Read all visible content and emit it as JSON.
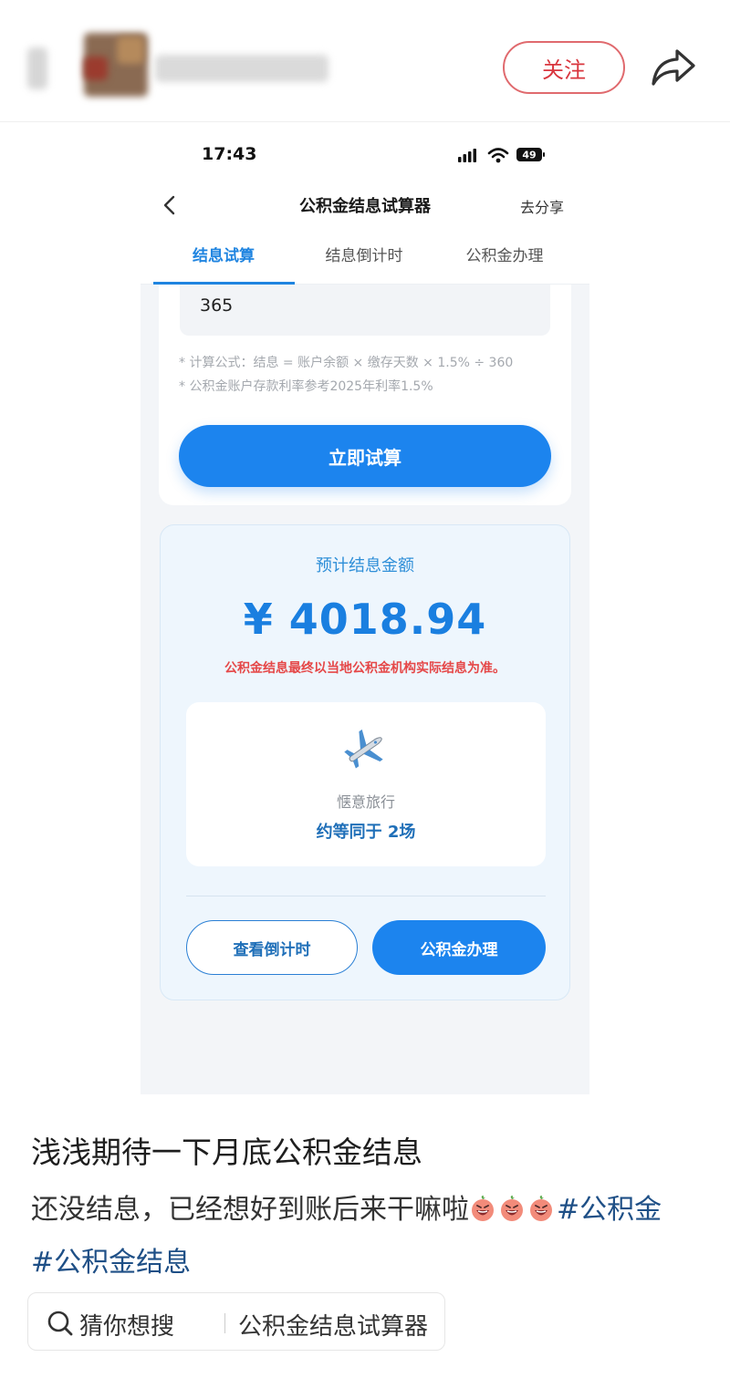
{
  "post_header": {
    "follow_label": "关注"
  },
  "phone": {
    "status_bar": {
      "time": "17:43",
      "battery": "49"
    },
    "navbar": {
      "title": "公积金结息试算器",
      "share_label": "去分享"
    },
    "tabs": [
      {
        "label": "结息试算",
        "active": true
      },
      {
        "label": "结息倒计时",
        "active": false
      },
      {
        "label": "公积金办理",
        "active": false
      }
    ],
    "form": {
      "days_value": "365",
      "formula_line1": "* 计算公式：结息 = 账户余额 × 缴存天数 × 1.5% ÷ 360",
      "formula_line2": "* 公积金账户存款利率参考2025年利率1.5%",
      "calc_button": "立即试算"
    },
    "result": {
      "label": "预计结息金额",
      "amount": "¥ 4018.94",
      "note": "公积金结息最终以当地公积金机构实际结息为准。",
      "travel_icon": "airplane-icon",
      "travel_label": "惬意旅行",
      "travel_value": "约等同于 2场",
      "countdown_button": "查看倒计时",
      "handle_button": "公积金办理"
    }
  },
  "post": {
    "title": "浅浅期待一下月底公积金结息",
    "body_text": "还没结息，已经想好到账后来干嘛啦",
    "emoji_icon": "laughing-peach-icon",
    "hashtags": [
      "#公积金",
      "#公积金结息"
    ],
    "search_chip": {
      "prefix": "猜你想搜",
      "query": "公积金结息试算器"
    }
  },
  "colors": {
    "accent_blue": "#1c84ee",
    "follow_red": "#d9363e",
    "warning_red": "#e54848",
    "hashtag_blue": "#1e4f86"
  }
}
